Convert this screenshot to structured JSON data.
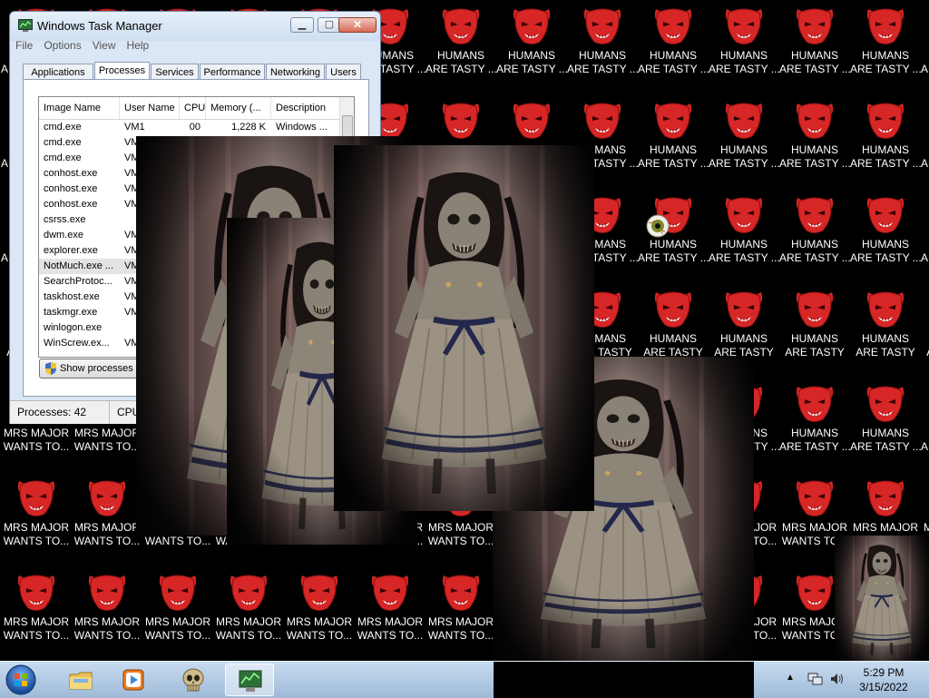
{
  "desktop": {
    "icon_rows": [
      {
        "kind": "humans",
        "label_lines": [
          "HUMANS",
          "ARE TASTY ..."
        ]
      },
      {
        "kind": "humans",
        "label_lines": [
          "HUMANS",
          "ARE TASTY ..."
        ]
      },
      {
        "kind": "humans",
        "label_lines": [
          "HUMANS",
          "ARE TASTY ..."
        ]
      },
      {
        "kind": "humans",
        "label_lines": [
          "HUMANS",
          "ARE TASTY"
        ]
      },
      {
        "kind": "mix",
        "label_lines": [
          "HUMANS",
          "ARE TASTY ..."
        ]
      },
      {
        "kind": "mrs",
        "label_lines": [
          "MRS MAJOR",
          "WANTS TO..."
        ]
      },
      {
        "kind": "mrs",
        "label_lines": [
          "MRS MAJOR",
          "WANTS TO..."
        ]
      }
    ],
    "labels": {
      "mrs": [
        "MRS MAJOR",
        "WANTS TO..."
      ],
      "humans": [
        "HUMANS",
        "ARE TASTY ..."
      ]
    },
    "colors": {
      "devil": "#d62626",
      "devil_dark": "#8a1010"
    }
  },
  "task_manager": {
    "title": "Windows Task Manager",
    "app_icon": "task-manager-icon",
    "menu": [
      "File",
      "Options",
      "View",
      "Help"
    ],
    "tabs": [
      "Applications",
      "Processes",
      "Services",
      "Performance",
      "Networking",
      "Users"
    ],
    "active_tab": "Processes",
    "columns": [
      "Image Name",
      "User Name",
      "CPU",
      "Memory (...",
      "Description"
    ],
    "processes": [
      {
        "image": "cmd.exe",
        "user": "VM1",
        "cpu": "00",
        "memory": "1,228 K",
        "description": "Windows ..."
      },
      {
        "image": "cmd.exe",
        "user": "VM",
        "cpu": "",
        "memory": "",
        "description": ""
      },
      {
        "image": "cmd.exe",
        "user": "VM",
        "cpu": "",
        "memory": "",
        "description": ""
      },
      {
        "image": "conhost.exe",
        "user": "VM",
        "cpu": "",
        "memory": "",
        "description": ""
      },
      {
        "image": "conhost.exe",
        "user": "VM",
        "cpu": "",
        "memory": "",
        "description": ""
      },
      {
        "image": "conhost.exe",
        "user": "VM",
        "cpu": "",
        "memory": "",
        "description": ""
      },
      {
        "image": "csrss.exe",
        "user": "",
        "cpu": "",
        "memory": "",
        "description": ""
      },
      {
        "image": "dwm.exe",
        "user": "VM",
        "cpu": "",
        "memory": "",
        "description": ""
      },
      {
        "image": "explorer.exe",
        "user": "VM",
        "cpu": "",
        "memory": "",
        "description": ""
      },
      {
        "image": "NotMuch.exe ...",
        "user": "VM",
        "cpu": "",
        "memory": "",
        "description": ""
      },
      {
        "image": "SearchProtoc...",
        "user": "VM",
        "cpu": "",
        "memory": "",
        "description": ""
      },
      {
        "image": "taskhost.exe",
        "user": "VM",
        "cpu": "",
        "memory": "",
        "description": ""
      },
      {
        "image": "taskmgr.exe",
        "user": "VM",
        "cpu": "",
        "memory": "",
        "description": ""
      },
      {
        "image": "winlogon.exe",
        "user": "",
        "cpu": "",
        "memory": "",
        "description": ""
      },
      {
        "image": "WinScrew.ex...",
        "user": "VM",
        "cpu": "",
        "memory": "",
        "description": ""
      }
    ],
    "selected_index": 9,
    "show_button": "Show processes f",
    "status": {
      "processes": "Processes: 42",
      "cpu": "CPU"
    }
  },
  "taskbar": {
    "apps": [
      "explorer-folder-icon",
      "media-player-icon",
      "skull-icon",
      "task-manager-icon"
    ],
    "active_app": "task-manager-icon",
    "clock_time": "5:29 PM",
    "clock_date": "3/15/2022"
  }
}
